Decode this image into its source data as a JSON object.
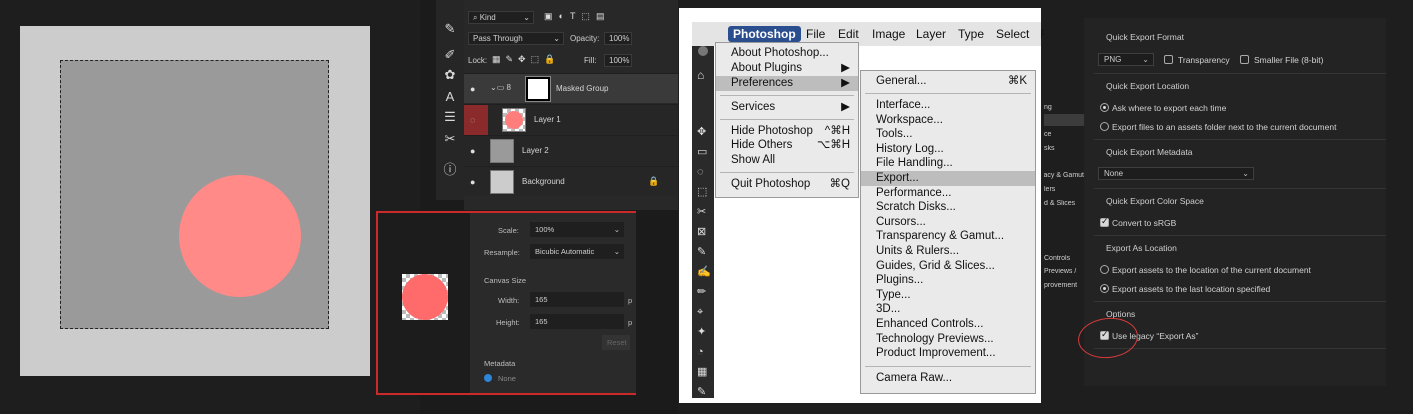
{
  "layers_panel": {
    "filter_kind": "Kind",
    "blend_mode": "Pass Through",
    "opacity_label": "Opacity:",
    "opacity_value": "100%",
    "lock_label": "Lock:",
    "fill_label": "Fill:",
    "fill_value": "100%",
    "layers": [
      {
        "name": "Masked Group"
      },
      {
        "name": "Layer 1"
      },
      {
        "name": "Layer 2"
      },
      {
        "name": "Background"
      }
    ]
  },
  "export_dialog": {
    "scale_label": "Scale:",
    "scale_value": "100%",
    "resample_label": "Resample:",
    "resample_value": "Bicubic Automatic",
    "canvas_size_label": "Canvas Size",
    "width_label": "Width:",
    "width_value": "165",
    "height_label": "Height:",
    "height_value": "165",
    "unit_short": "p",
    "reset_label": "Reset",
    "metadata_label": "Metadata",
    "metadata_option": "None"
  },
  "menubar": {
    "items": [
      "Photoshop",
      "File",
      "Edit",
      "Image",
      "Layer",
      "Type",
      "Select",
      "Filt"
    ]
  },
  "app_menu": {
    "items": [
      {
        "label": "About Photoshop...",
        "shortcut": ""
      },
      {
        "label": "About Plugins",
        "shortcut": "▶"
      },
      {
        "label": "Preferences",
        "shortcut": "▶"
      },
      {
        "label": "Services",
        "shortcut": "▶"
      },
      {
        "label": "Hide Photoshop",
        "shortcut": "^⌘H"
      },
      {
        "label": "Hide Others",
        "shortcut": "⌥⌘H"
      },
      {
        "label": "Show All",
        "shortcut": ""
      },
      {
        "label": "Quit Photoshop",
        "shortcut": "⌘Q"
      }
    ]
  },
  "prefs_menu": {
    "items": [
      {
        "label": "General...",
        "shortcut": "⌘K"
      },
      {
        "label": "Interface...",
        "shortcut": ""
      },
      {
        "label": "Workspace...",
        "shortcut": ""
      },
      {
        "label": "Tools...",
        "shortcut": ""
      },
      {
        "label": "History Log...",
        "shortcut": ""
      },
      {
        "label": "File Handling...",
        "shortcut": ""
      },
      {
        "label": "Export...",
        "shortcut": ""
      },
      {
        "label": "Performance...",
        "shortcut": ""
      },
      {
        "label": "Scratch Disks...",
        "shortcut": ""
      },
      {
        "label": "Cursors...",
        "shortcut": ""
      },
      {
        "label": "Transparency & Gamut...",
        "shortcut": ""
      },
      {
        "label": "Units & Rulers...",
        "shortcut": ""
      },
      {
        "label": "Guides, Grid & Slices...",
        "shortcut": ""
      },
      {
        "label": "Plugins...",
        "shortcut": ""
      },
      {
        "label": "Type...",
        "shortcut": ""
      },
      {
        "label": "3D...",
        "shortcut": ""
      },
      {
        "label": "Enhanced Controls...",
        "shortcut": ""
      },
      {
        "label": "Technology Previews...",
        "shortcut": ""
      },
      {
        "label": "Product Improvement...",
        "shortcut": ""
      },
      {
        "label": "Camera Raw...",
        "shortcut": ""
      }
    ]
  },
  "prefs_sidebar": {
    "items": [
      "ng",
      "ce",
      "sks",
      "acy & Gamut",
      "lers",
      "d & Slices",
      "Controls",
      "/ Previews",
      "provement"
    ]
  },
  "export_prefs": {
    "qe_format_title": "Quick Export Format",
    "format_value": "PNG",
    "transparency_label": "Transparency",
    "smaller_file_label": "Smaller File (8-bit)",
    "qe_location_title": "Quick Export Location",
    "loc_ask": "Ask where to export each time",
    "loc_assets": "Export files to an assets folder next to the current document",
    "qe_metadata_title": "Quick Export Metadata",
    "metadata_value": "None",
    "qe_colorspace_title": "Quick Export Color Space",
    "convert_srgb": "Convert to sRGB",
    "export_as_location_title": "Export As Location",
    "eal_current": "Export assets to the location of the current document",
    "eal_last": "Export assets to the last location specified",
    "options_title": "Options",
    "legacy_label": "Use legacy “Export As”"
  },
  "colors": {
    "circle": "#ff8a88",
    "selection_red": "#cc2a2a",
    "menu_highlight": "#2b4f8e"
  }
}
